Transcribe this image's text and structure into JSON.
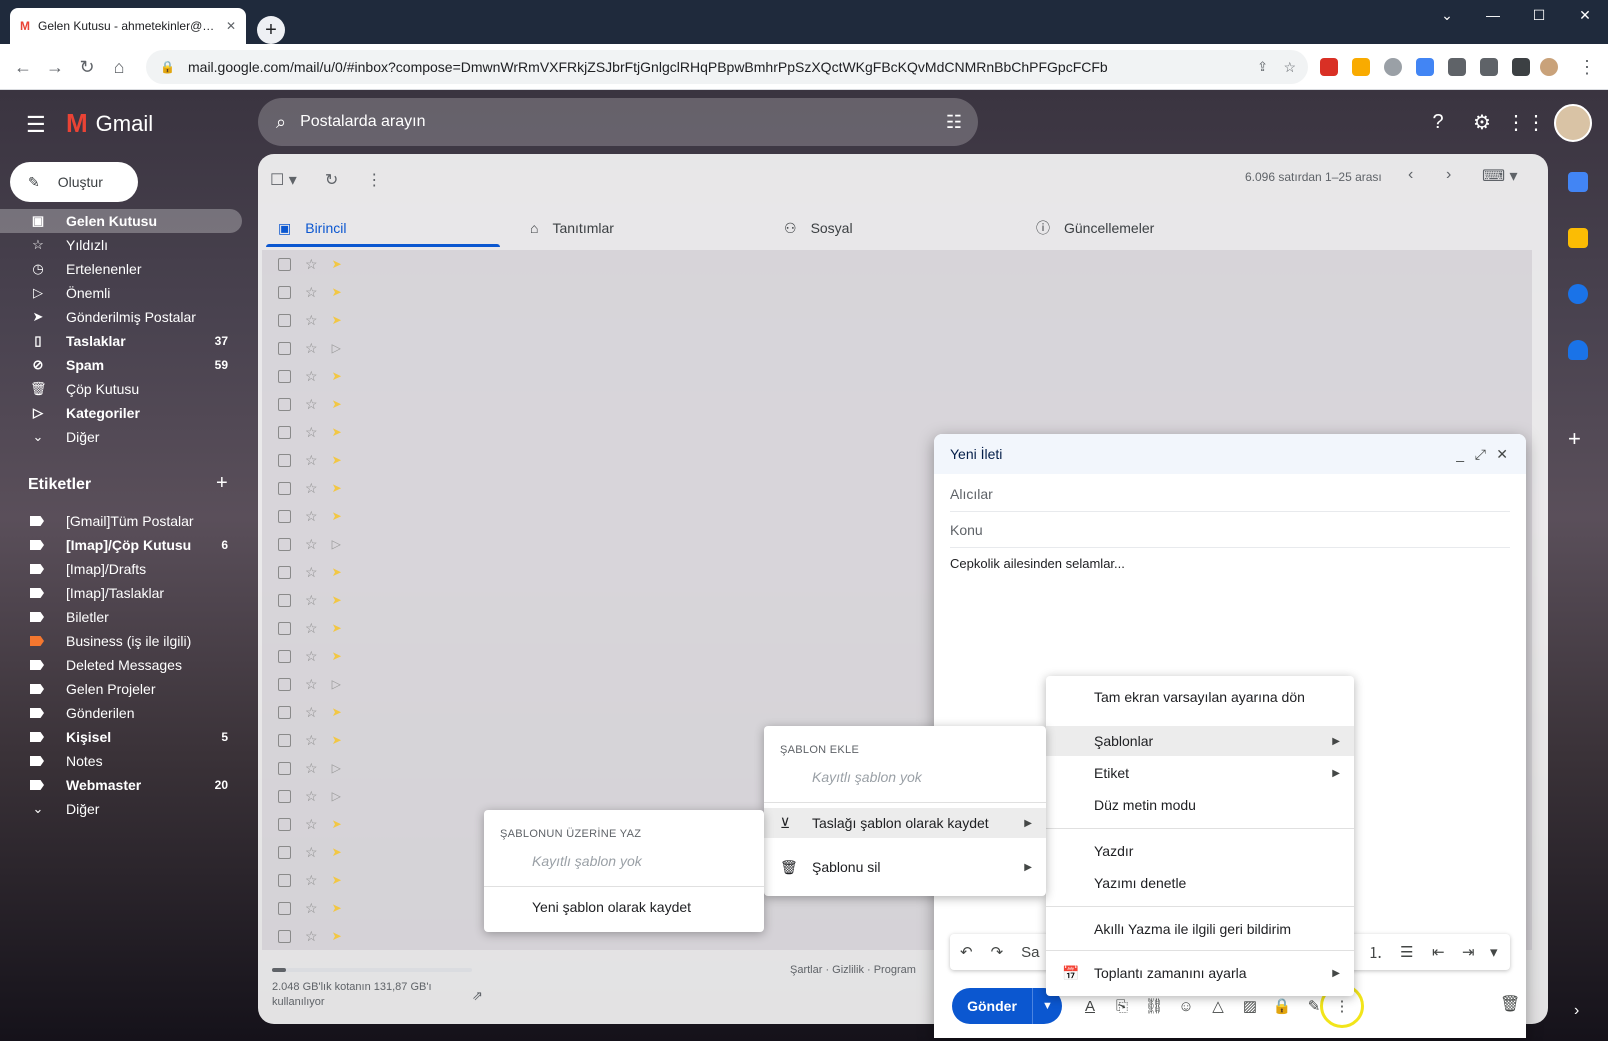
{
  "browser": {
    "tab_title": "Gelen Kutusu - ahmetekinler@gmail.com - Gmail",
    "new_tab": "+",
    "url": "mail.google.com/mail/u/0/#inbox?compose=DmwnWrRmVXFRkjZSJbrFtjGnlgclRHqPBpwBmhrPpSzXQctWKgFBcKQvMdCNMRnBbChPFGpcFCFb"
  },
  "gmail": {
    "brand": "Gmail",
    "search_placeholder": "Postalarda arayın",
    "compose_label": "Oluştur",
    "nav": [
      {
        "label": "Gelen Kutusu",
        "count": ""
      },
      {
        "label": "Yıldızlı",
        "count": ""
      },
      {
        "label": "Ertelenenler",
        "count": ""
      },
      {
        "label": "Önemli",
        "count": ""
      },
      {
        "label": "Gönderilmiş Postalar",
        "count": ""
      },
      {
        "label": "Taslaklar",
        "count": "37"
      },
      {
        "label": "Spam",
        "count": "59"
      },
      {
        "label": "Çöp Kutusu",
        "count": ""
      },
      {
        "label": "Kategoriler",
        "count": ""
      },
      {
        "label": "Diğer",
        "count": ""
      }
    ],
    "labels_title": "Etiketler",
    "labels": [
      {
        "label": "[Gmail]Tüm Postalar",
        "count": ""
      },
      {
        "label": "[Imap]/Çöp Kutusu",
        "count": "6"
      },
      {
        "label": "[Imap]/Drafts",
        "count": ""
      },
      {
        "label": "[Imap]/Taslaklar",
        "count": ""
      },
      {
        "label": "Biletler",
        "count": ""
      },
      {
        "label": "Business (iş ile ilgili)",
        "count": ""
      },
      {
        "label": "Deleted Messages",
        "count": ""
      },
      {
        "label": "Gelen Projeler",
        "count": ""
      },
      {
        "label": "Gönderilen",
        "count": ""
      },
      {
        "label": "Kişisel",
        "count": "5"
      },
      {
        "label": "Notes",
        "count": ""
      },
      {
        "label": "Webmaster",
        "count": "20"
      },
      {
        "label": "Diğer",
        "count": ""
      }
    ],
    "pager": "6.096 satırdan 1–25 arası",
    "tabs": [
      "Birincil",
      "Tanıtımlar",
      "Sosyal",
      "Güncellemeler"
    ],
    "storage": "2.048 GB'lık kotanın 131,87 GB'ı kullanılıyor",
    "footer": "Şartlar · Gizlilik · Program"
  },
  "compose": {
    "title": "Yeni İleti",
    "to_placeholder": "Alıcılar",
    "subject_placeholder": "Konu",
    "body": "Cepkolik ailesinden selamlar...",
    "send": "Gönder",
    "fmt_font": "Sa"
  },
  "menus": {
    "more": [
      "Tam ekran varsayılan ayarına dön",
      "Şablonlar",
      "Etiket",
      "Düz metin modu",
      "Yazdır",
      "Yazımı denetle",
      "Akıllı Yazma ile ilgili geri bildirim",
      "Toplantı zamanını ayarla"
    ],
    "templates": {
      "header": "ŞABLON EKLE",
      "none": "Kayıtlı şablon yok",
      "save_draft": "Taslağı şablon olarak kaydet",
      "delete": "Şablonu sil"
    },
    "overwrite": {
      "header": "ŞABLONUN ÜZERİNE YAZ",
      "none": "Kayıtlı şablon yok",
      "save_new": "Yeni şablon olarak kaydet"
    }
  }
}
